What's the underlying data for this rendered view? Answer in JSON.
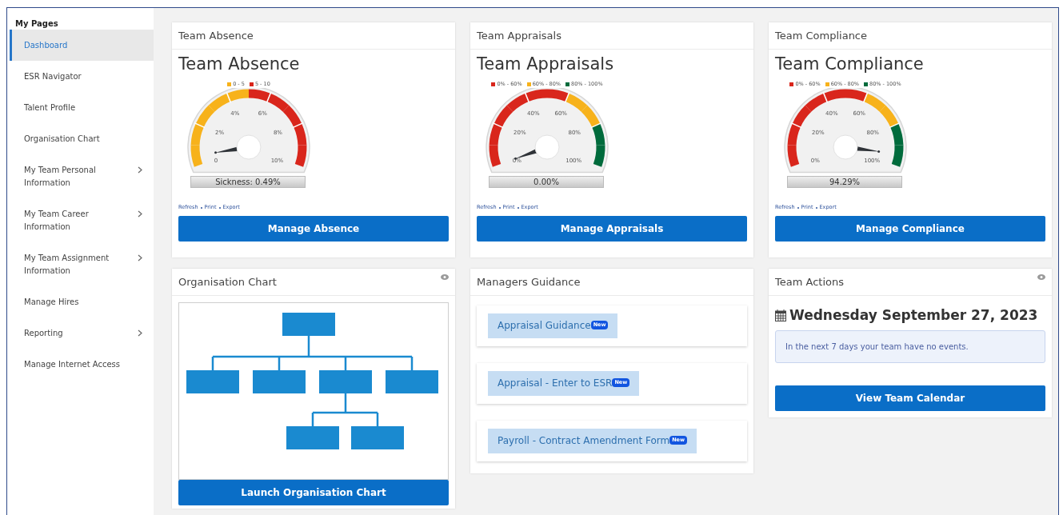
{
  "sidebar": {
    "heading": "My Pages",
    "items": [
      {
        "label": "Dashboard",
        "selected": true,
        "has_submenu": false
      },
      {
        "label": "ESR Navigator",
        "selected": false,
        "has_submenu": false
      },
      {
        "label": "Talent Profile",
        "selected": false,
        "has_submenu": false
      },
      {
        "label": "Organisation Chart",
        "selected": false,
        "has_submenu": false
      },
      {
        "label": "My Team Personal Information",
        "selected": false,
        "has_submenu": true
      },
      {
        "label": "My Team Career Information",
        "selected": false,
        "has_submenu": true
      },
      {
        "label": "My Team Assignment Information",
        "selected": false,
        "has_submenu": true
      },
      {
        "label": "Manage Hires",
        "selected": false,
        "has_submenu": false
      },
      {
        "label": "Reporting",
        "selected": false,
        "has_submenu": true
      },
      {
        "label": "Manage Internet Access",
        "selected": false,
        "has_submenu": false
      }
    ]
  },
  "gauge_cards": [
    {
      "header": "Team Absence",
      "title": "Team Absence",
      "legend": [
        {
          "label": "0 - 5",
          "color": "#f7b21b"
        },
        {
          "label": "5 - 10",
          "color": "#d9261c"
        }
      ],
      "dial_bands": [
        {
          "color": "#f7b21b"
        },
        {
          "color": "#f7b21b"
        },
        {
          "color": "#f7b21b"
        },
        {
          "color": "#f7b21b"
        },
        {
          "color": "#f7b21b"
        },
        {
          "color": "#d9261c"
        },
        {
          "color": "#d9261c"
        },
        {
          "color": "#d9261c"
        },
        {
          "color": "#d9261c"
        },
        {
          "color": "#d9261c"
        }
      ],
      "ticks": [
        "0",
        "2%",
        "4%",
        "6%",
        "8%",
        "10%"
      ],
      "level": 0.049,
      "reading": "Sickness: 0.49%",
      "links": [
        "Refresh",
        "Print",
        "Export"
      ],
      "button": "Manage Absence"
    },
    {
      "header": "Team Appraisals",
      "title": "Team Appraisals",
      "legend": [
        {
          "label": "0% - 60%",
          "color": "#d9261c"
        },
        {
          "label": "60% - 80%",
          "color": "#f7b21b"
        },
        {
          "label": "80% - 100%",
          "color": "#006b3c"
        }
      ],
      "dial_bands": [
        {
          "color": "#d9261c"
        },
        {
          "color": "#d9261c"
        },
        {
          "color": "#d9261c"
        },
        {
          "color": "#d9261c"
        },
        {
          "color": "#d9261c"
        },
        {
          "color": "#d9261c"
        },
        {
          "color": "#f7b21b"
        },
        {
          "color": "#f7b21b"
        },
        {
          "color": "#006b3c"
        },
        {
          "color": "#006b3c"
        }
      ],
      "ticks": [
        "0%",
        "20%",
        "40%",
        "60%",
        "80%",
        "100%"
      ],
      "level": 0,
      "reading": "0.00%",
      "links": [
        "Refresh",
        "Print",
        "Export"
      ],
      "button": "Manage Appraisals"
    },
    {
      "header": "Team Compliance",
      "title": "Team Compliance",
      "legend": [
        {
          "label": "0% - 60%",
          "color": "#d9261c"
        },
        {
          "label": "60% - 80%",
          "color": "#f7b21b"
        },
        {
          "label": "80% - 100%",
          "color": "#006b3c"
        }
      ],
      "dial_bands": [
        {
          "color": "#d9261c"
        },
        {
          "color": "#d9261c"
        },
        {
          "color": "#d9261c"
        },
        {
          "color": "#d9261c"
        },
        {
          "color": "#d9261c"
        },
        {
          "color": "#d9261c"
        },
        {
          "color": "#f7b21b"
        },
        {
          "color": "#f7b21b"
        },
        {
          "color": "#006b3c"
        },
        {
          "color": "#006b3c"
        }
      ],
      "ticks": [
        "0%",
        "20%",
        "40%",
        "60%",
        "80%",
        "100%"
      ],
      "level": 0.9429,
      "reading": "94.29%",
      "links": [
        "Refresh",
        "Print",
        "Export"
      ],
      "button": "Manage Compliance"
    }
  ],
  "org_card": {
    "header": "Organisation Chart",
    "button": "Launch Organisation Chart"
  },
  "guidance_card": {
    "header": "Managers Guidance",
    "items": [
      {
        "label": "Appraisal Guidance",
        "badge": "New"
      },
      {
        "label": "Appraisal - Enter to ESR",
        "badge": "New"
      },
      {
        "label": "Payroll - Contract Amendment Form",
        "badge": "New"
      }
    ]
  },
  "actions_card": {
    "header": "Team Actions",
    "date": "Wednesday September 27, 2023",
    "message": "In the next 7 days your team have no events.",
    "button": "View Team Calendar"
  }
}
